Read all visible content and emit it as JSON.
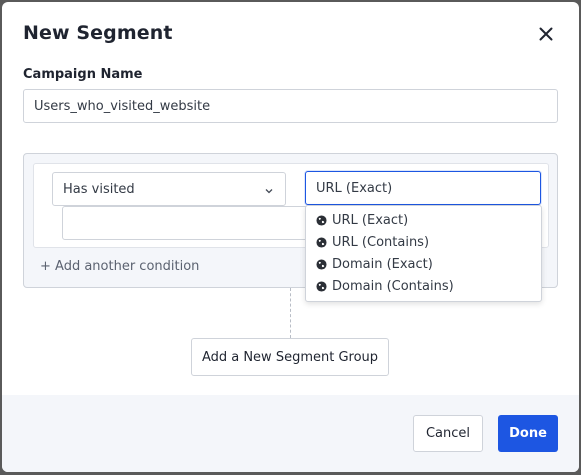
{
  "dialog": {
    "title": "New Segment"
  },
  "campaign": {
    "label": "Campaign Name",
    "value": "Users_who_visited_website"
  },
  "condition": {
    "rule_select_value": "Has visited",
    "type_input_value": "URL (Exact)",
    "value_input_value": "",
    "add_condition_label": "+ Add another condition"
  },
  "dropdown": {
    "options": [
      {
        "label": "URL (Exact)",
        "icon": "globe-icon"
      },
      {
        "label": "URL (Contains)",
        "icon": "globe-icon"
      },
      {
        "label": "Domain (Exact)",
        "icon": "globe-icon"
      },
      {
        "label": "Domain (Contains)",
        "icon": "globe-icon"
      }
    ]
  },
  "add_group_label": "Add a New Segment Group",
  "footer": {
    "cancel_label": "Cancel",
    "done_label": "Done"
  },
  "colors": {
    "accent": "#1d56e2",
    "panel_background": "#f4f6fa",
    "border": "#cfd3da"
  }
}
